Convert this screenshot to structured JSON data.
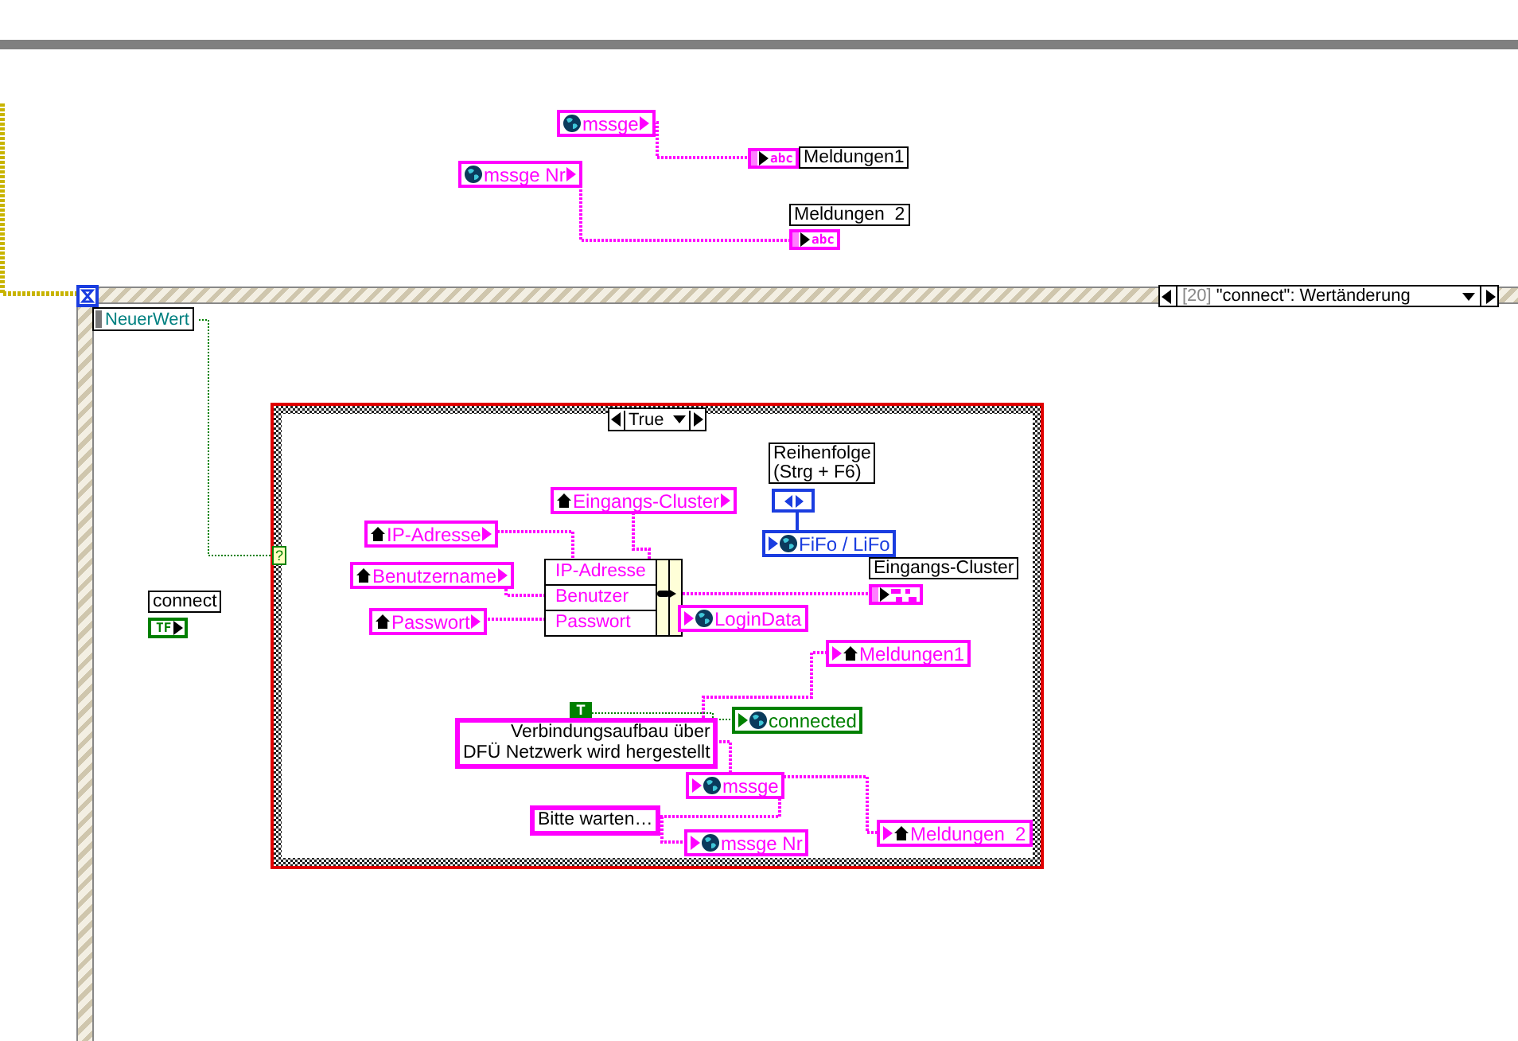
{
  "top_nodes": [
    {
      "kind": "global_read",
      "text": "mssge",
      "color": "#ff00ff"
    },
    {
      "kind": "global_read",
      "text": "mssge Nr",
      "color": "#ff00ff"
    },
    {
      "kind": "indicator",
      "text": "Meldungen1",
      "glyph": "abc",
      "color": "#ff00ff"
    },
    {
      "kind": "indicator",
      "text": "Meldungen  2",
      "glyph": "abc",
      "color": "#ff00ff"
    }
  ],
  "event_structure": {
    "selector_index": "[20]",
    "selector": "\"connect\": Wertänderung",
    "event_data": "NeuerWert",
    "nodes": [
      {
        "kind": "control",
        "text": "connect",
        "glyph": "TF",
        "color": "#008000"
      }
    ]
  },
  "case_structure": {
    "selector_terminal": "?",
    "selector": "True",
    "nodes": [
      {
        "kind": "label",
        "text": "Reihenfolge\n(Strg + F6)"
      },
      {
        "kind": "ring_constant",
        "color": "#1a3de0"
      },
      {
        "kind": "global_write",
        "text": "FiFo / LiFo",
        "color": "#1a3de0"
      },
      {
        "kind": "local_read",
        "text": "Eingangs-Cluster",
        "color": "#ff00ff"
      },
      {
        "kind": "local_read",
        "text": "IP-Adresse",
        "color": "#ff00ff"
      },
      {
        "kind": "local_read",
        "text": "Benutzername",
        "color": "#ff00ff"
      },
      {
        "kind": "local_read",
        "text": "Passwort",
        "color": "#ff00ff"
      },
      {
        "kind": "bundle",
        "rows": [
          "IP-Adresse",
          "Benutzer",
          "Passwort"
        ],
        "color": "#ff00ff"
      },
      {
        "kind": "indicator",
        "text": "Eingangs-Cluster",
        "color": "#ff00ff"
      },
      {
        "kind": "global_write",
        "text": "LoginData",
        "color": "#ff00ff"
      },
      {
        "kind": "local_write",
        "text": "Meldungen1",
        "color": "#ff00ff"
      },
      {
        "kind": "bool_constant",
        "text": "T",
        "color": "#008000"
      },
      {
        "kind": "string_constant",
        "text": "Verbindungsaufbau über\nDFÜ Netzwerk wird hergestellt",
        "color": "#ff00ff"
      },
      {
        "kind": "global_write",
        "text": "connected",
        "color": "#008000"
      },
      {
        "kind": "global_write",
        "text": "mssge",
        "color": "#ff00ff"
      },
      {
        "kind": "string_constant",
        "text": "Bitte warten…",
        "color": "#ff00ff"
      },
      {
        "kind": "local_write",
        "text": "Meldungen  2",
        "color": "#ff00ff"
      },
      {
        "kind": "global_write",
        "text": "mssge Nr",
        "color": "#ff00ff"
      }
    ]
  }
}
